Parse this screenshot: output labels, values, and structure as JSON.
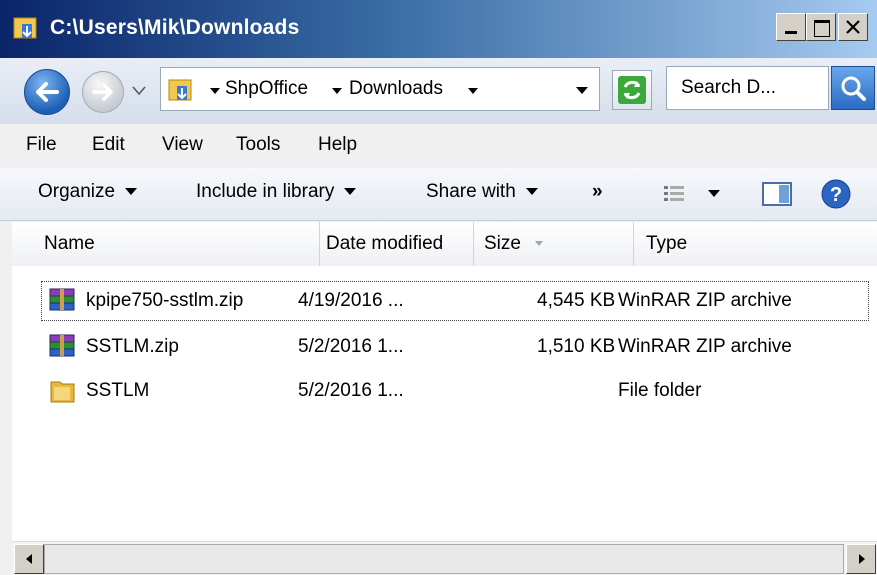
{
  "window": {
    "title": "C:\\Users\\Mik\\Downloads",
    "minimize_label": "_",
    "restore_label": "□",
    "close_label": "×"
  },
  "nav": {
    "breadcrumbs": [
      "ShpOffice",
      "Downloads"
    ],
    "search_placeholder": "Search D..."
  },
  "menu": {
    "items": [
      "File",
      "Edit",
      "View",
      "Tools",
      "Help"
    ]
  },
  "commands": {
    "organize": "Organize",
    "include_in_library": "Include in library",
    "share_with": "Share with",
    "more": "»"
  },
  "columns": {
    "name": "Name",
    "date_modified": "Date modified",
    "size": "Size",
    "type": "Type"
  },
  "files": [
    {
      "name": "kpipe750-sstlm.zip",
      "date": "4/19/2016 ...",
      "size": "4,545 KB",
      "type": "WinRAR ZIP archive",
      "icon": "winrar-archive-icon"
    },
    {
      "name": "SSTLM.zip",
      "date": "5/2/2016 1...",
      "size": "1,510 KB",
      "type": "WinRAR ZIP archive",
      "icon": "winrar-archive-icon"
    },
    {
      "name": "SSTLM",
      "date": "5/2/2016 1...",
      "size": "",
      "type": "File folder",
      "icon": "folder-icon"
    }
  ],
  "colors": {
    "title_bar_start": "#0a246a",
    "title_bar_end": "#a6caf0",
    "background": "#f0f0f0"
  }
}
